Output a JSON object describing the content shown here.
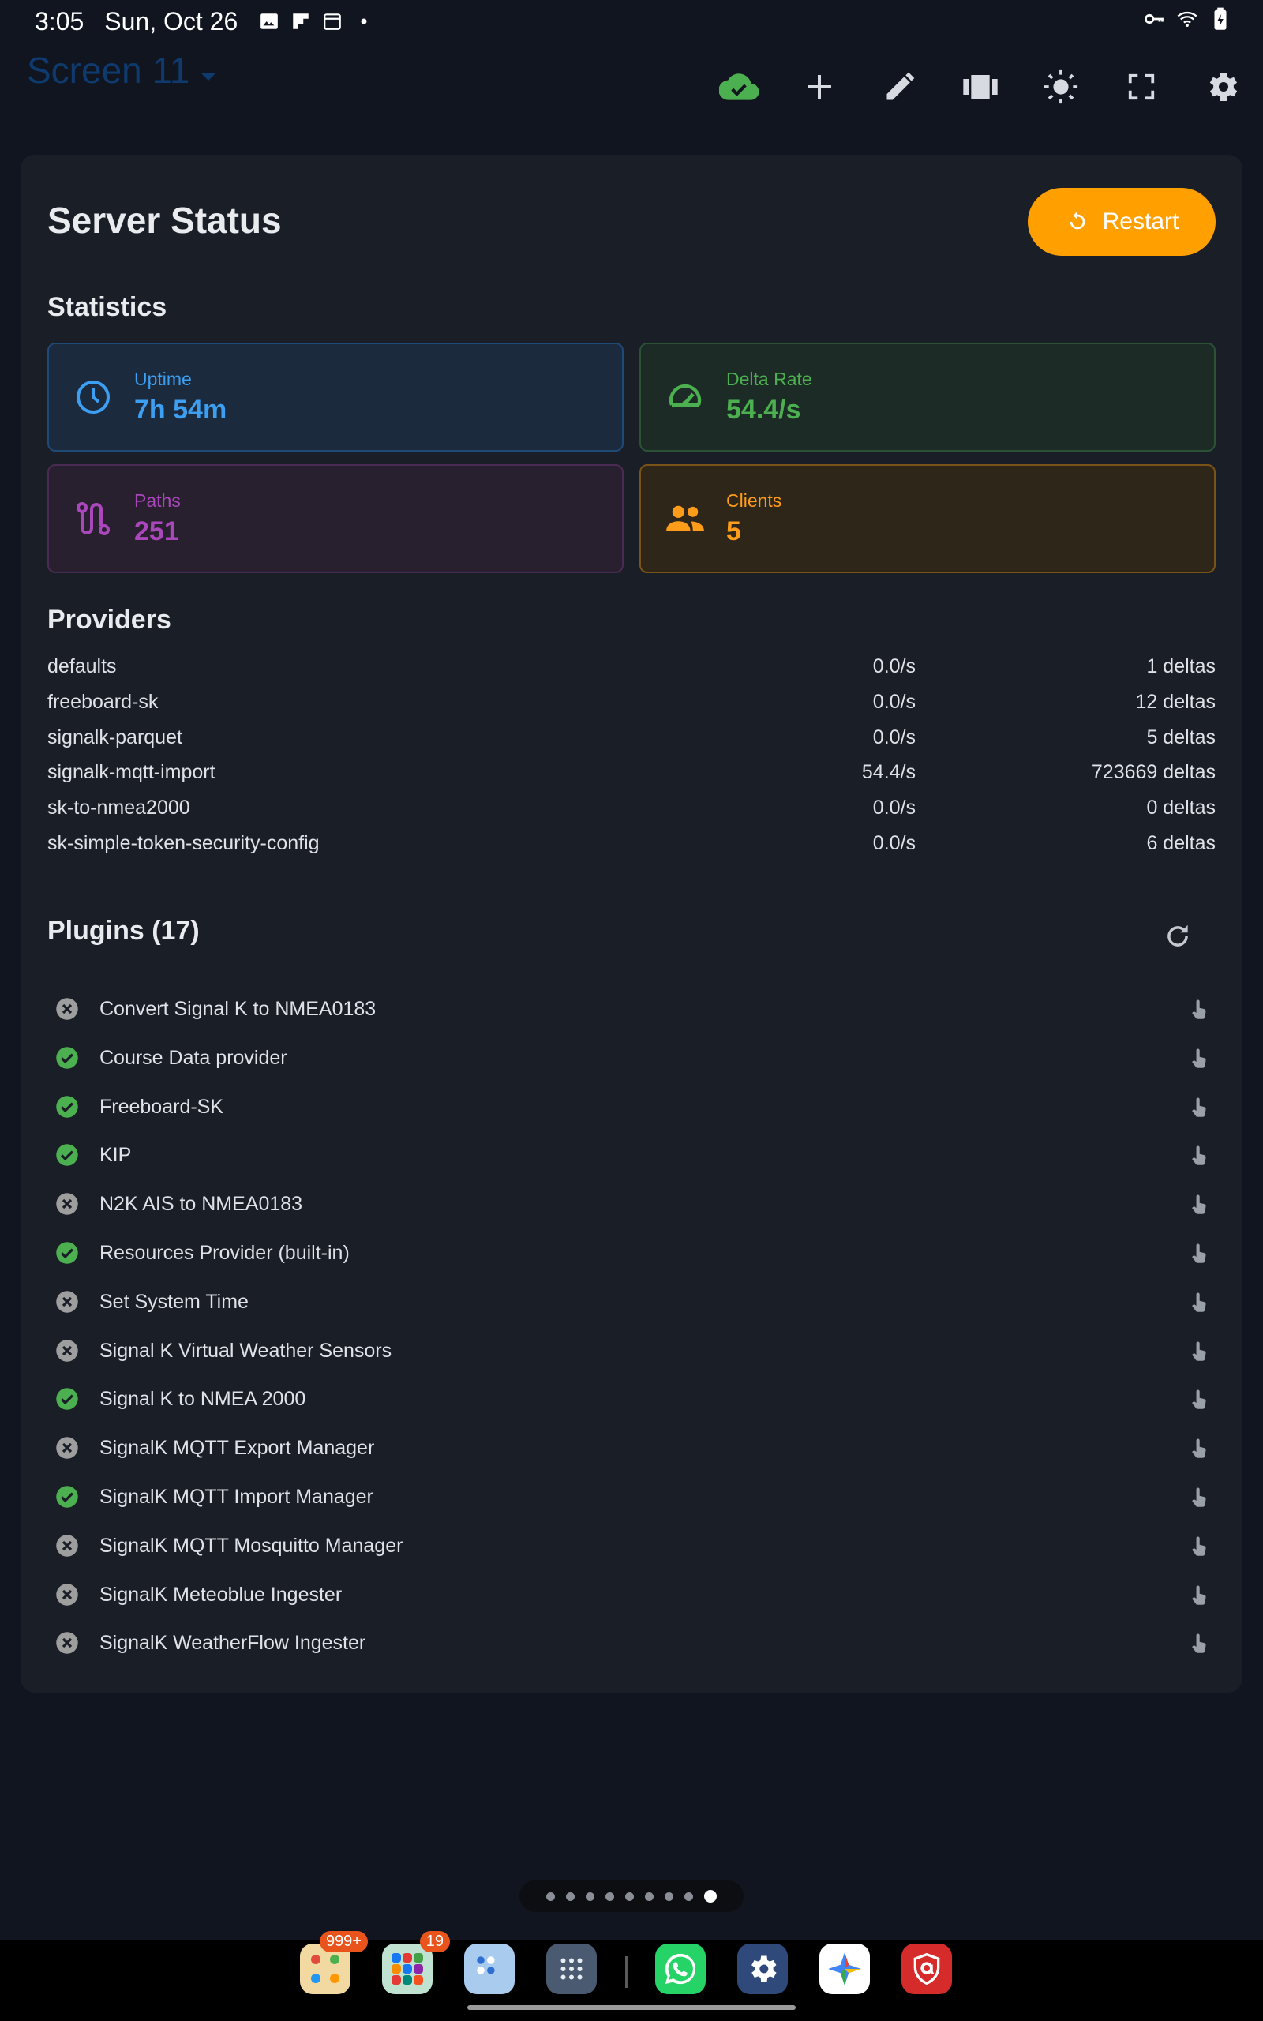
{
  "status_bar": {
    "time": "3:05",
    "date": "Sun, Oct 26"
  },
  "toolbar": {
    "screen_title": "Screen 11",
    "icons": [
      "cloud-check-icon",
      "add-icon",
      "edit-icon",
      "carousel-icon",
      "brightness-icon",
      "fullscreen-icon",
      "settings-icon"
    ]
  },
  "server": {
    "title": "Server Status",
    "restart_label": "Restart"
  },
  "statistics": {
    "title": "Statistics",
    "uptime": {
      "label": "Uptime",
      "value": "7h 54m"
    },
    "delta_rate": {
      "label": "Delta Rate",
      "value": "54.4/s"
    },
    "paths": {
      "label": "Paths",
      "value": "251"
    },
    "clients": {
      "label": "Clients",
      "value": "5"
    }
  },
  "providers": {
    "title": "Providers",
    "rows": [
      {
        "name": "defaults",
        "rate": "0.0/s",
        "count": "1 deltas"
      },
      {
        "name": "freeboard-sk",
        "rate": "0.0/s",
        "count": "12 deltas"
      },
      {
        "name": "signalk-parquet",
        "rate": "0.0/s",
        "count": "5 deltas"
      },
      {
        "name": "signalk-mqtt-import",
        "rate": "54.4/s",
        "count": "723669 deltas"
      },
      {
        "name": "sk-to-nmea2000",
        "rate": "0.0/s",
        "count": "0 deltas"
      },
      {
        "name": "sk-simple-token-security-config",
        "rate": "0.0/s",
        "count": "6 deltas"
      }
    ]
  },
  "plugins": {
    "title": "Plugins (17)",
    "items": [
      {
        "name": "Convert Signal K to NMEA0183",
        "enabled": false
      },
      {
        "name": "Course Data provider",
        "enabled": true
      },
      {
        "name": "Freeboard-SK",
        "enabled": true
      },
      {
        "name": "KIP",
        "enabled": true
      },
      {
        "name": "N2K AIS to NMEA0183",
        "enabled": false
      },
      {
        "name": "Resources Provider (built-in)",
        "enabled": true
      },
      {
        "name": "Set System Time",
        "enabled": false
      },
      {
        "name": "Signal K Virtual Weather Sensors",
        "enabled": false
      },
      {
        "name": "Signal K to NMEA 2000",
        "enabled": true
      },
      {
        "name": "SignalK MQTT Export Manager",
        "enabled": false
      },
      {
        "name": "SignalK MQTT Import Manager",
        "enabled": true
      },
      {
        "name": "SignalK MQTT Mosquitto Manager",
        "enabled": false
      },
      {
        "name": "SignalK Meteoblue Ingester",
        "enabled": false
      },
      {
        "name": "SignalK WeatherFlow Ingester",
        "enabled": false
      }
    ]
  },
  "pager": {
    "count": 9,
    "active": 9
  },
  "dock": {
    "apps": [
      {
        "name": "folder-app",
        "badge": "999+"
      },
      {
        "name": "folder-app-2",
        "badge": "19"
      },
      {
        "name": "folder-app-3",
        "badge": ""
      },
      {
        "name": "app-drawer",
        "badge": ""
      },
      {
        "name": "whatsapp",
        "badge": ""
      },
      {
        "name": "settings",
        "badge": ""
      },
      {
        "name": "photos",
        "badge": ""
      },
      {
        "name": "security-app",
        "badge": ""
      }
    ]
  },
  "colors": {
    "accent_orange": "#ffa000",
    "ok_green": "#4caf50",
    "off_grey": "#9e9e9e",
    "uptime_blue": "#3d9ff2",
    "paths_purple": "#ab47bc",
    "clients_orange": "#ff9c1a"
  }
}
